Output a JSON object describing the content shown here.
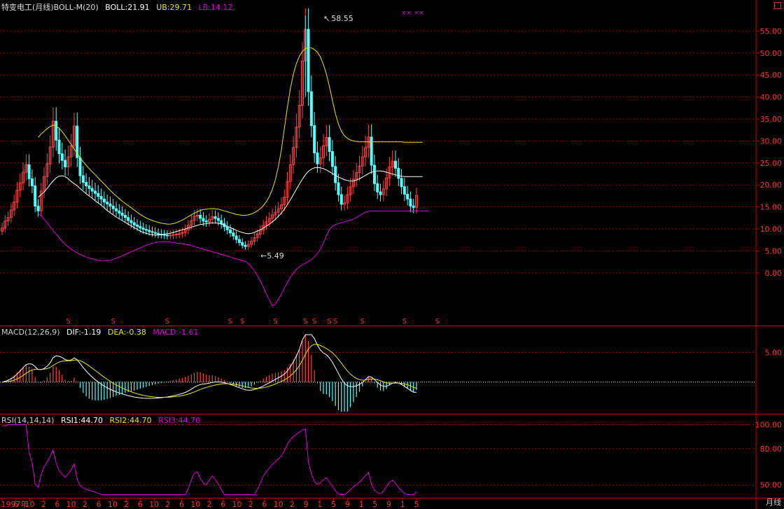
{
  "main_header": {
    "stock": "特变电工(月线)",
    "indicator": "BOLL-M(20)",
    "boll": "BOLL:21.91",
    "ub": "UB:29.71",
    "lb": "LB:14.12"
  },
  "macd_header": {
    "name": "MACD(12,26,9)",
    "dif": "DIF:-1.19",
    "dea": "DEA:-0.38",
    "macd": "MACD:-1.61"
  },
  "rsi_header": {
    "name": "RSI(14,14,14)",
    "rsi1": "RSI1:44.70",
    "rsi2": "RSI2:44.70",
    "rsi3": "RSI3:44.70"
  },
  "annotations": {
    "high": "58.55",
    "low": "5.49",
    "marks": "×× ××"
  },
  "period_mode": "月线",
  "colors": {
    "background": "#000000",
    "grid": "#c00000",
    "up": "#ff4040",
    "down": "#54ffff",
    "boll": "#ffffff",
    "ub": "#e8e800",
    "lb": "#e000e0",
    "axis_text": "#ff3030"
  },
  "chart_data": [
    {
      "type": "candlestick",
      "title": "特变电工(月线)",
      "y_ticks": [
        "55.00",
        "50.00",
        "45.00",
        "40.00",
        "35.00",
        "30.00",
        "25.00",
        "20.00",
        "15.00",
        "10.00",
        "5.00",
        "0.00"
      ],
      "ylim": [
        -8,
        60
      ],
      "x_tick_labels": [
        "1997年",
        "6",
        "10",
        "2",
        "6",
        "10",
        "2",
        "6",
        "10",
        "2",
        "6",
        "10",
        "2",
        "6",
        "10",
        "2",
        "6",
        "10",
        "2",
        "6",
        "10",
        "2",
        "9",
        "1",
        "5",
        "9",
        "1",
        "5",
        "9",
        "1",
        "5"
      ],
      "marker": "S",
      "signal_months": [
        22,
        37,
        55,
        76,
        80,
        91,
        101,
        104,
        109,
        111,
        120,
        134,
        145
      ],
      "close": [
        10.2,
        11.8,
        12.6,
        14.3,
        16.1,
        18.8,
        20.5,
        22.9,
        24.6,
        21.4,
        19.8,
        15.2,
        14.1,
        18.6,
        21.9,
        24.8,
        28.6,
        34.5,
        30.2,
        27.1,
        25.6,
        24.1,
        26.4,
        28.9,
        33.4,
        26.2,
        22.1,
        20.6,
        19.8,
        19.2,
        18.6,
        18.1,
        17.4,
        16.8,
        16.1,
        15.7,
        15.2,
        14.6,
        14.1,
        13.6,
        13.1,
        12.6,
        11.9,
        11.4,
        10.9,
        10.6,
        10.2,
        9.9,
        9.7,
        9.4,
        9.2,
        9.0,
        8.8,
        8.7,
        8.6,
        8.5,
        8.6,
        8.7,
        8.8,
        8.9,
        9.2,
        9.8,
        10.8,
        11.9,
        12.9,
        13.1,
        12.4,
        11.8,
        11.6,
        12.2,
        12.8,
        12.4,
        11.9,
        11.2,
        10.5,
        9.8,
        9.1,
        8.4,
        7.6,
        6.9,
        6.3,
        6.0,
        6.5,
        7.2,
        8.0,
        8.8,
        9.7,
        10.8,
        11.6,
        12.4,
        13.2,
        13.8,
        14.6,
        15.5,
        17.2,
        20.8,
        24.6,
        28.5,
        33.2,
        38.1,
        48.2,
        55.4,
        41.2,
        33.5,
        27.3,
        24.8,
        26.2,
        28.9,
        30.8,
        27.6,
        24.2,
        20.5,
        17.8,
        15.6,
        15.9,
        17.8,
        19.6,
        21.3,
        22.8,
        24.3,
        26.4,
        28.5,
        30.9,
        24.5,
        20.3,
        18.4,
        17.8,
        19.1,
        21.6,
        24.1,
        25.4,
        23.8,
        21.5,
        19.6,
        17.9,
        16.8,
        15.2,
        14.9,
        17.6
      ],
      "mid_series": [
        null,
        null,
        null,
        null,
        null,
        null,
        null,
        null,
        null,
        null,
        null,
        null,
        17.2,
        17.8,
        18.4,
        19.2,
        20.1,
        20.9,
        21.6,
        22.0,
        22.1,
        21.9,
        21.4,
        20.8,
        20.3,
        19.8,
        19.2,
        18.6,
        18.0,
        17.5,
        17.0,
        16.4,
        15.9,
        15.4,
        14.8,
        14.2,
        13.7,
        13.2,
        12.7,
        12.3,
        11.9,
        11.5,
        11.1,
        10.7,
        10.3,
        9.9,
        9.5,
        9.2,
        9.0,
        8.8,
        8.7,
        8.6,
        8.6,
        8.7,
        8.8,
        8.9,
        9.0,
        9.2,
        9.4,
        9.6,
        9.8,
        10.0,
        10.2,
        10.4,
        10.6,
        10.8,
        11.0,
        11.1,
        11.2,
        11.3,
        11.4,
        11.4,
        11.3,
        11.1,
        10.9,
        10.6,
        10.3,
        10.0,
        9.7,
        9.4,
        9.2,
        9.0,
        8.9,
        9.0,
        9.2,
        9.5,
        9.8,
        10.2,
        10.6,
        11.1,
        11.6,
        12.2,
        12.9,
        13.6,
        14.5,
        15.5,
        16.6,
        17.8,
        19.0,
        20.2,
        21.3,
        22.3,
        23.1,
        23.6,
        23.9,
        24.0,
        23.9,
        23.7,
        23.4,
        23.0,
        22.6,
        22.2,
        21.8,
        21.5,
        21.2,
        21.0,
        20.9,
        20.9,
        21.1,
        21.4,
        21.8,
        22.2,
        22.6,
        22.9,
        23.1,
        23.2,
        23.2,
        23.1,
        22.9,
        22.7,
        22.5,
        22.3,
        22.1,
        22.0,
        21.9,
        21.9,
        21.9,
        21.9,
        21.9,
        21.9,
        21.9
      ],
      "ub_series": [
        null,
        null,
        null,
        null,
        null,
        null,
        null,
        null,
        null,
        null,
        null,
        null,
        30.8,
        31.6,
        32.2,
        32.8,
        33.3,
        33.6,
        33.4,
        32.9,
        32.1,
        31.2,
        30.2,
        29.2,
        28.2,
        27.2,
        26.2,
        25.3,
        24.5,
        23.7,
        23.0,
        22.3,
        21.6,
        20.9,
        20.2,
        19.5,
        18.8,
        18.1,
        17.5,
        16.9,
        16.3,
        15.8,
        15.3,
        14.8,
        14.3,
        13.8,
        13.3,
        12.9,
        12.5,
        12.2,
        11.9,
        11.7,
        11.5,
        11.3,
        11.2,
        11.1,
        11.1,
        11.2,
        11.4,
        11.7,
        12.0,
        12.4,
        12.8,
        13.2,
        13.6,
        13.9,
        14.2,
        14.4,
        14.5,
        14.6,
        14.6,
        14.6,
        14.5,
        14.3,
        14.1,
        13.9,
        13.7,
        13.5,
        13.3,
        13.2,
        13.1,
        13.1,
        13.2,
        13.4,
        13.7,
        14.1,
        14.6,
        15.3,
        16.2,
        17.4,
        19.0,
        21.2,
        24.2,
        28.0,
        32.8,
        37.6,
        41.9,
        45.2,
        47.6,
        49.3,
        50.4,
        51.0,
        51.3,
        51.2,
        50.8,
        50.2,
        49.1,
        47.4,
        45.2,
        42.4,
        39.2,
        36.2,
        33.8,
        32.2,
        31.2,
        30.6,
        30.2,
        30.0,
        29.9,
        29.8,
        29.8,
        29.8,
        29.8,
        29.8,
        29.8,
        29.8,
        29.8,
        29.8,
        29.8,
        29.8,
        29.8,
        29.8,
        29.8,
        29.8,
        29.7,
        29.7,
        29.7,
        29.7,
        29.7,
        29.7,
        29.7
      ],
      "lb_series": [
        null,
        null,
        null,
        null,
        null,
        null,
        null,
        null,
        null,
        null,
        null,
        null,
        13.5,
        13.0,
        12.2,
        11.4,
        10.5,
        9.6,
        8.8,
        8.0,
        7.2,
        6.5,
        5.9,
        5.4,
        5.0,
        4.6,
        4.2,
        3.9,
        3.6,
        3.4,
        3.2,
        3.0,
        2.9,
        2.8,
        2.8,
        2.8,
        2.9,
        3.1,
        3.3,
        3.6,
        3.9,
        4.2,
        4.5,
        4.8,
        5.1,
        5.4,
        5.7,
        6.0,
        6.3,
        6.5,
        6.7,
        6.9,
        7.0,
        7.1,
        7.1,
        7.1,
        7.0,
        6.9,
        6.8,
        6.7,
        6.6,
        6.5,
        6.4,
        6.2,
        6.0,
        5.8,
        5.6,
        5.4,
        5.2,
        5.0,
        4.8,
        4.6,
        4.4,
        4.2,
        4.0,
        3.8,
        3.6,
        3.4,
        3.2,
        3.0,
        2.8,
        2.6,
        2.1,
        1.4,
        0.5,
        -0.6,
        -1.8,
        -3.2,
        -4.8,
        -6.2,
        -7.5,
        -7.1,
        -6.0,
        -4.8,
        -3.5,
        -2.2,
        -1.0,
        0.0,
        0.8,
        1.4,
        1.8,
        2.2,
        2.6,
        3.0,
        3.6,
        4.4,
        5.4,
        6.8,
        8.4,
        9.8,
        10.6,
        11.0,
        11.2,
        11.4,
        11.6,
        11.8,
        12.0,
        12.2,
        12.6,
        13.0,
        13.4,
        13.8,
        14.0,
        14.1,
        14.1,
        14.1,
        14.1,
        14.1,
        14.1,
        14.1,
        14.1,
        14.1,
        14.1,
        14.1,
        14.1,
        14.1,
        14.1,
        14.1,
        14.1,
        14.1,
        14.1,
        14.1,
        14.1
      ]
    },
    {
      "type": "bar",
      "title": "MACD(12,26,9)",
      "y_ticks": [
        "5.00"
      ],
      "ylim": [
        -5,
        8
      ]
    },
    {
      "type": "line",
      "title": "RSI(14,14,14)",
      "y_ticks": [
        "100.00",
        "80.00",
        "50.00"
      ],
      "ylim": [
        40,
        102
      ]
    }
  ]
}
